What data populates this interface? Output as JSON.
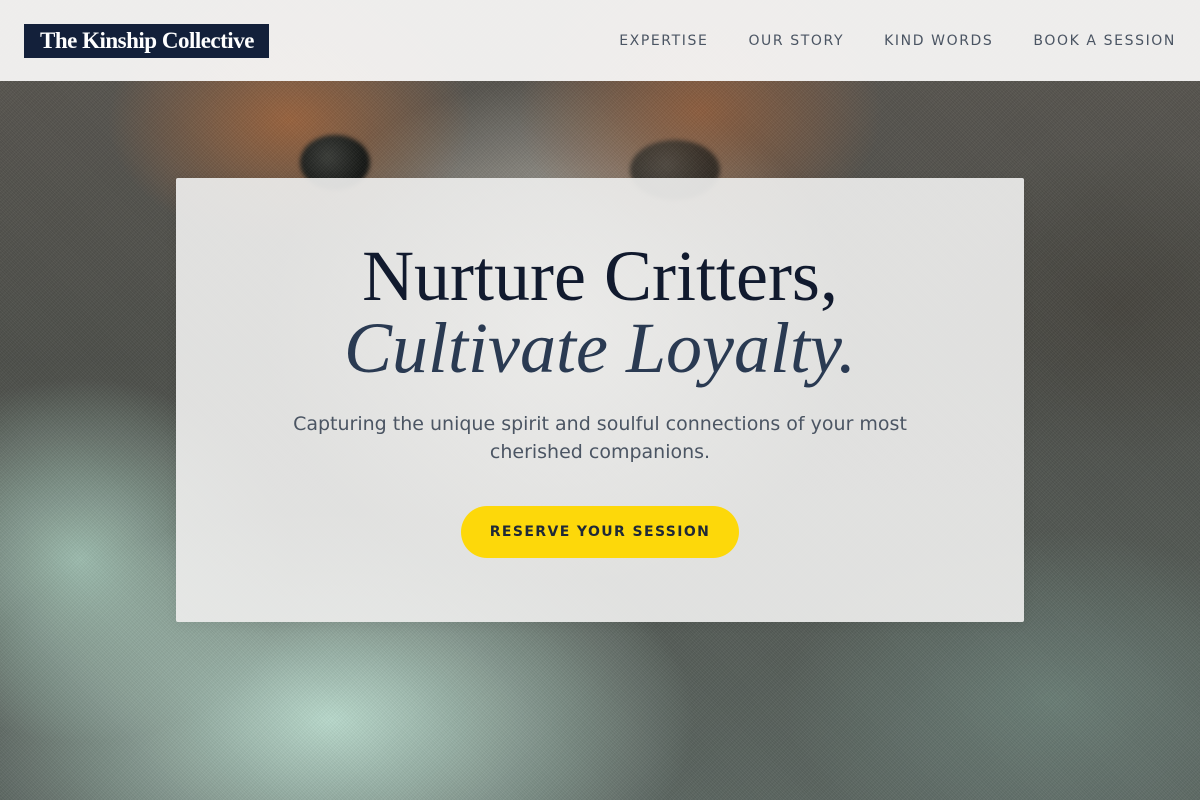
{
  "header": {
    "logo": "The Kinship Collective",
    "nav": [
      {
        "label": "EXPERTISE"
      },
      {
        "label": "OUR STORY"
      },
      {
        "label": "KIND WORDS"
      },
      {
        "label": "BOOK A SESSION"
      }
    ]
  },
  "hero": {
    "headline_line1": "Nurture Critters,",
    "headline_line2": "Cultivate Loyalty.",
    "subtitle": "Capturing the unique spirit and soulful connections of your most cherished companions.",
    "cta_label": "RESERVE YOUR SESSION"
  },
  "colors": {
    "logo_bg": "#13203a",
    "cta_bg": "#fdd80a",
    "headline": "#111a2e"
  }
}
